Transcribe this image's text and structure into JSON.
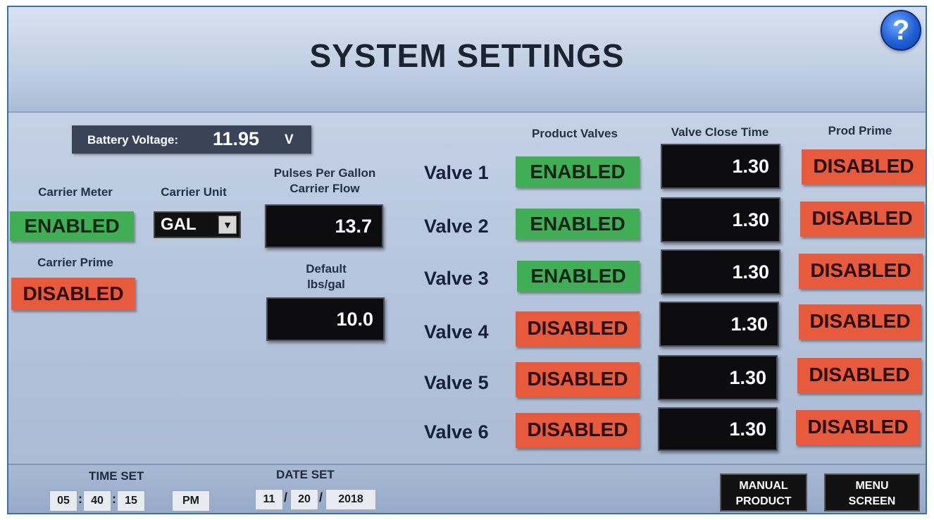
{
  "header": {
    "title": "SYSTEM SETTINGS",
    "help_label": "?"
  },
  "battery": {
    "label": "Battery Voltage:",
    "value": "11.95",
    "unit": "V"
  },
  "carrier": {
    "meter_label": "Carrier Meter",
    "meter_state": "ENABLED",
    "unit_label": "Carrier Unit",
    "unit_value": "GAL",
    "prime_label": "Carrier Prime",
    "prime_state": "DISABLED",
    "ppg_label_line1": "Pulses Per Gallon",
    "ppg_label_line2": "Carrier Flow",
    "ppg_value": "13.7",
    "default_label_line1": "Default",
    "default_label_line2": "lbs/gal",
    "default_value": "10.0"
  },
  "valves": {
    "col_product": "Product Valves",
    "col_close": "Valve Close Time",
    "col_prime": "Prod Prime",
    "rows": [
      {
        "name": "Valve 1",
        "state": "ENABLED",
        "close": "1.30",
        "prime": "DISABLED"
      },
      {
        "name": "Valve 2",
        "state": "ENABLED",
        "close": "1.30",
        "prime": "DISABLED"
      },
      {
        "name": "Valve 3",
        "state": "ENABLED",
        "close": "1.30",
        "prime": "DISABLED"
      },
      {
        "name": "Valve 4",
        "state": "DISABLED",
        "close": "1.30",
        "prime": "DISABLED"
      },
      {
        "name": "Valve 5",
        "state": "DISABLED",
        "close": "1.30",
        "prime": "DISABLED"
      },
      {
        "name": "Valve 6",
        "state": "DISABLED",
        "close": "1.30",
        "prime": "DISABLED"
      }
    ]
  },
  "footer": {
    "time_label": "TIME SET",
    "time": {
      "hour": "05",
      "minute": "40",
      "second": "15",
      "ampm": "PM"
    },
    "date_label": "DATE SET",
    "date": {
      "month": "11",
      "day": "20",
      "year": "2018"
    },
    "manual_line1": "MANUAL",
    "manual_line2": "PRODUCT",
    "menu_line1": "MENU",
    "menu_line2": "SCREEN"
  },
  "colors": {
    "enabled": "#3fae55",
    "disabled": "#e85a3c",
    "value_box": "#0c0c0e",
    "background": "#b9c8df"
  }
}
